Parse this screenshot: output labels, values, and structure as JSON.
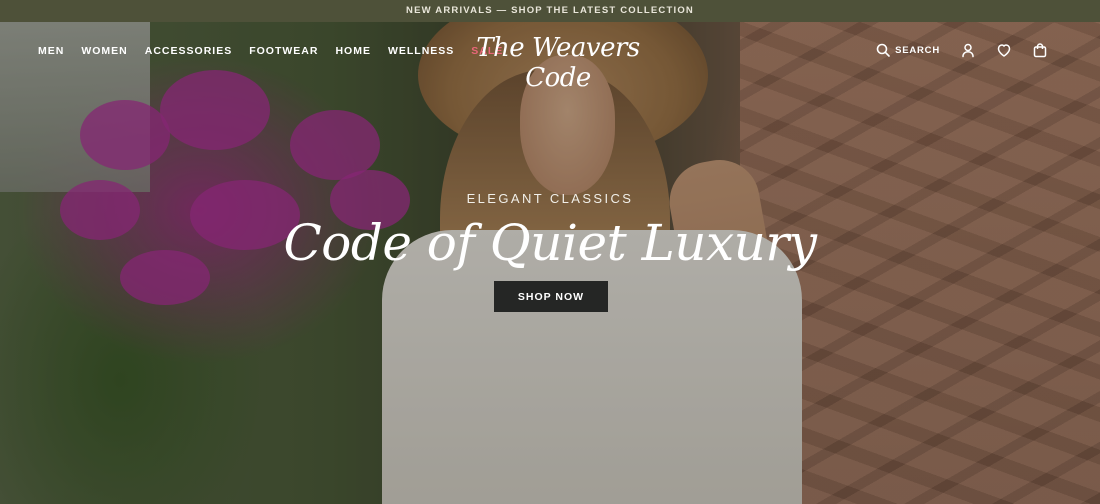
{
  "announcement": "NEW ARRIVALS — SHOP THE LATEST COLLECTION",
  "nav": {
    "items": [
      "MEN",
      "WOMEN",
      "ACCESSORIES",
      "FOOTWEAR",
      "HOME",
      "WELLNESS",
      "SALE"
    ]
  },
  "brand": "The Weavers Code",
  "tools": {
    "search_label": "SEARCH"
  },
  "hero": {
    "eyebrow": "ELEGANT CLASSICS",
    "headline": "Code of Quiet Luxury",
    "cta_label": "SHOP NOW"
  },
  "colors": {
    "announcement_bg": "#4e5139",
    "sale": "#e8677a",
    "cta_bg": "#252625"
  },
  "icons": [
    "search-icon",
    "account-icon",
    "wishlist-heart-icon",
    "shopping-bag-icon"
  ]
}
